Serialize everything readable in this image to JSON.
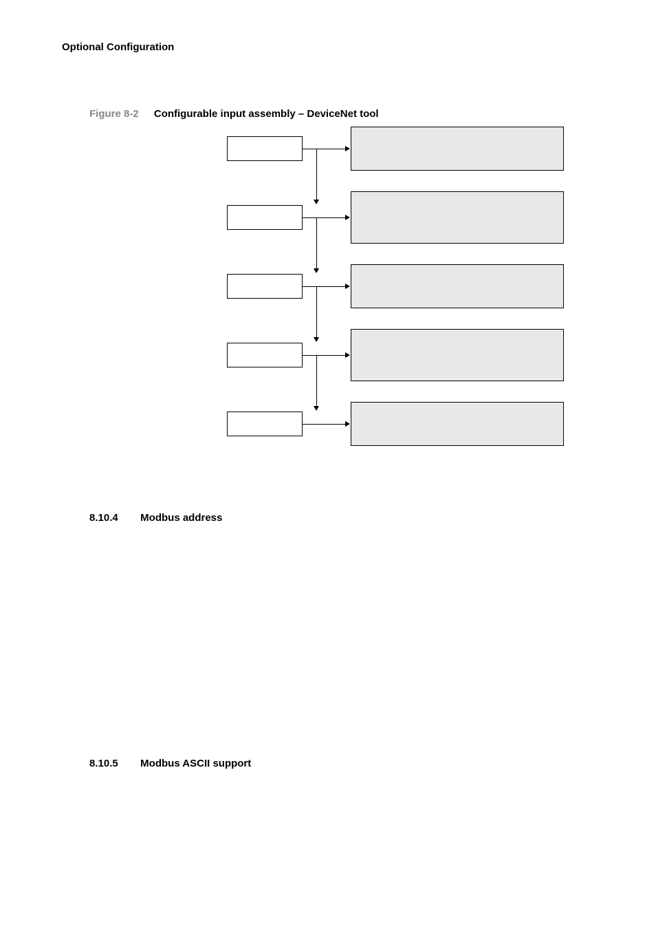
{
  "header": "Optional Configuration",
  "figure": {
    "number": "Figure 8-2",
    "title": "Configurable input assembly – DeviceNet tool"
  },
  "sections": [
    {
      "num": "8.10.4",
      "title": "Modbus address"
    },
    {
      "num": "8.10.5",
      "title": "Modbus ASCII support"
    }
  ]
}
